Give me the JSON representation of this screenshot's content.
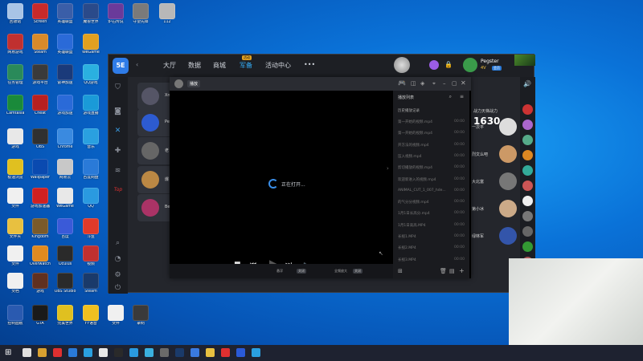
{
  "desktop": {
    "icons": [
      {
        "label": "回收站",
        "color": "#a8c4e6"
      },
      {
        "label": "Screen",
        "color": "#c82a2a"
      },
      {
        "label": "英雄联盟",
        "color": "#3a5ea8"
      },
      {
        "label": "魔兽世界",
        "color": "#2a4a8a"
      },
      {
        "label": "炉石传说",
        "color": "#6a3a9a"
      },
      {
        "label": "守望先锋",
        "color": "#7a7a7a"
      },
      {
        "label": "112",
        "color": "#b8b8b8"
      },
      {
        "label": "网易游戏",
        "color": "#c03030"
      },
      {
        "label": "Steam",
        "color": "#d88a2a"
      },
      {
        "label": "英雄联盟",
        "color": "#2a6ad8"
      },
      {
        "label": "WeGame",
        "color": "#e0a020"
      },
      {
        "label": "任务管理",
        "color": "#2a8a5a"
      },
      {
        "label": "游戏平台",
        "color": "#3a3a3a"
      },
      {
        "label": "雷神加速",
        "color": "#1a3a7a"
      },
      {
        "label": "QQ游戏",
        "color": "#2ab0e0"
      },
      {
        "label": "Camtasia",
        "color": "#1a8a3a"
      },
      {
        "label": "Cheat",
        "color": "#b82020"
      },
      {
        "label": "游戏加速",
        "color": "#2a6ad8"
      },
      {
        "label": "游戏直播",
        "color": "#1a9ad8"
      },
      {
        "label": "游戏",
        "color": "#e8e8e8"
      },
      {
        "label": "OBS",
        "color": "#303030"
      },
      {
        "label": "Chrome",
        "color": "#3a8ae0"
      },
      {
        "label": "音乐",
        "color": "#2aa0e0"
      },
      {
        "label": "极速浏览",
        "color": "#e0c020"
      },
      {
        "label": "Wallpaper",
        "color": "#0a4ab0"
      },
      {
        "label": "网易云",
        "color": "#c8c8c8"
      },
      {
        "label": "百度网盘",
        "color": "#2a7ad8"
      },
      {
        "label": "文件",
        "color": "#f0f0f0"
      },
      {
        "label": "游戏加速器",
        "color": "#d02020"
      },
      {
        "label": "WeGame",
        "color": "#e8e8e8"
      },
      {
        "label": "QQ",
        "color": "#2a9ae0"
      },
      {
        "label": "文件夹",
        "color": "#e8c040"
      },
      {
        "label": "Kingdom",
        "color": "#7a5a2a"
      },
      {
        "label": "百度",
        "color": "#3a5ad8"
      },
      {
        "label": "斗鱼",
        "color": "#e03a2a"
      },
      {
        "label": "文件",
        "color": "#f0f0f0"
      },
      {
        "label": "Overwatch",
        "color": "#e08a20"
      },
      {
        "label": "Oculus",
        "color": "#2a2a2a"
      },
      {
        "label": "视频",
        "color": "#c03030"
      },
      {
        "label": "文档",
        "color": "#f0f0f0"
      },
      {
        "label": "游戏",
        "color": "#603020"
      },
      {
        "label": "OBS Studio",
        "color": "#2a2a2a"
      },
      {
        "label": "Steam",
        "color": "#1a3a6a"
      },
      {
        "label": "控制面板",
        "color": "#2a5ab0"
      },
      {
        "label": "GTA",
        "color": "#1a1a1a"
      },
      {
        "label": "完美世界",
        "color": "#e0c020"
      },
      {
        "label": "YY语音",
        "color": "#f0c020"
      },
      {
        "label": "文件",
        "color": "#f0f0f0"
      },
      {
        "label": "录制",
        "color": "#3a3a3a"
      }
    ]
  },
  "client": {
    "logo": "5E",
    "nav": [
      "大厅",
      "数据",
      "商城",
      "军备",
      "活动中心"
    ],
    "more": "•••",
    "hot_badge": "活动",
    "user": {
      "name": "Pegster",
      "level": "4V",
      "vip": "会员"
    },
    "score_label": "战力天梯战力",
    "score": "1630",
    "players": [
      {
        "name": "Xm",
        "color": "#556"
      },
      {
        "name": "Pe",
        "color": "#2d5bd0"
      },
      {
        "name": "老",
        "color": "#666"
      },
      {
        "name": "爆",
        "color": "#b84"
      },
      {
        "name": "Bel",
        "color": "#a36"
      }
    ],
    "right": [
      {
        "name": "一次平",
        "color": "#ddd"
      },
      {
        "name": "烈文么吧",
        "color": "#c96"
      },
      {
        "name": "大北富",
        "color": "#777"
      },
      {
        "name": "第小冰",
        "color": "#ca8"
      },
      {
        "name": "绿林军",
        "color": "#35a"
      }
    ]
  },
  "player": {
    "title": "播放",
    "loading": "正在打开...",
    "playlist_title": "播放列表",
    "history": "历史播放记录",
    "items": [
      {
        "name": "第一开始的视频.mp4",
        "dur": "00:00"
      },
      {
        "name": "第一开始的视频.mp4",
        "dur": "00:00"
      },
      {
        "name": "开方法的视频.mp4",
        "dur": "00:00"
      },
      {
        "name": "压入视频.mp4",
        "dur": "00:00"
      },
      {
        "name": "剪切播放的视频.mp4",
        "dur": "00:00"
      },
      {
        "name": "欢迎新进入的视频.mp4",
        "dur": "00:00"
      },
      {
        "name": "ANIMAL_CUT_1_007_hde...",
        "dur": "00:00"
      },
      {
        "name": "的气分分视频.mp4",
        "dur": "00:00"
      },
      {
        "name": "1月1日长高分.mp4",
        "dur": "00:00"
      },
      {
        "name": "1月1日高高.MP4",
        "dur": "00:00"
      },
      {
        "name": "长视1.MP4",
        "dur": "00:00"
      },
      {
        "name": "长视2.MP4",
        "dur": "00:00"
      },
      {
        "name": "长视3.MP4",
        "dur": "00:00"
      }
    ],
    "bottom": {
      "left": "悬浮",
      "left_tag": "关闭",
      "right": "全频放大",
      "right_tag": "关闭"
    }
  },
  "taskbar": {
    "colors": [
      "#e0e0e0",
      "#d8a030",
      "#e03030",
      "#2a7ad8",
      "#2aa0e0",
      "#e8e8e8",
      "#2a2a2a",
      "#2a9ae0",
      "#3ab0e0",
      "#6a6a6a",
      "#1a3a6a",
      "#3a7ae0",
      "#e8c040",
      "#e03030",
      "#2a5ad8",
      "#2aa0e0"
    ]
  }
}
